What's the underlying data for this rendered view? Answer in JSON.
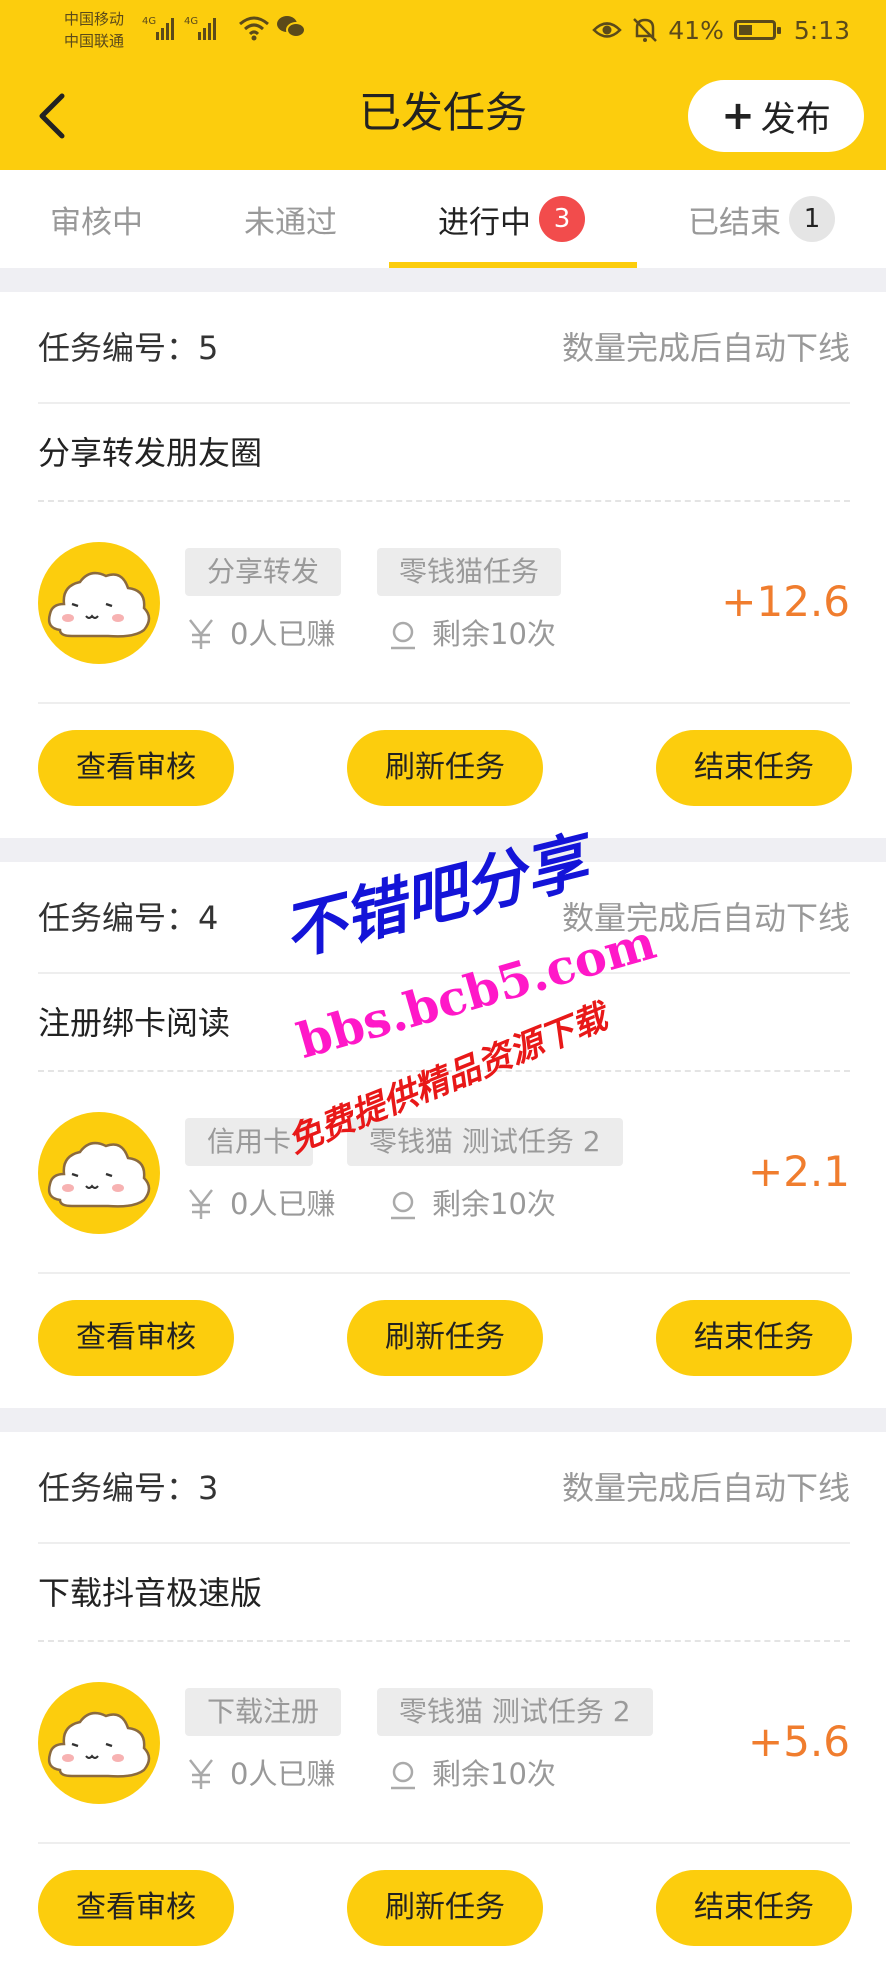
{
  "status_bar": {
    "carrier_1": "中国移动",
    "carrier_2": "中国联通",
    "net_1": "4G",
    "net_2": "4G",
    "battery_percent": "41%",
    "battery_level": 0.41,
    "time": "5:13"
  },
  "header": {
    "title": "已发任务",
    "publish_label": "发布",
    "publish_plus": "+",
    "background_color": "#fccd0d"
  },
  "tabs": [
    {
      "label": "审核中"
    },
    {
      "label": "未通过"
    },
    {
      "label": "进行中",
      "badge": "3",
      "active": true
    },
    {
      "label": "已结束",
      "badge": "1"
    }
  ],
  "tasks": [
    {
      "number_label": "任务编号：5",
      "offline_note": "数量完成后自动下线",
      "name": "分享转发朋友圈",
      "tags": [
        "分享转发",
        "零钱猫任务"
      ],
      "earned": "0人已赚",
      "remaining": "剩余10次",
      "reward": "+12.6",
      "actions": [
        "查看审核",
        "刷新任务",
        "结束任务"
      ]
    },
    {
      "number_label": "任务编号：4",
      "offline_note": "数量完成后自动下线",
      "name": "注册绑卡阅读",
      "tags": [
        "信用卡",
        "零钱猫 测试任务 2"
      ],
      "earned": "0人已赚",
      "remaining": "剩余10次",
      "reward": "+2.1",
      "actions": [
        "查看审核",
        "刷新任务",
        "结束任务"
      ]
    },
    {
      "number_label": "任务编号：3",
      "offline_note": "数量完成后自动下线",
      "name": "下载抖音极速版",
      "tags": [
        "下载注册",
        "零钱猫 测试任务 2"
      ],
      "earned": "0人已赚",
      "remaining": "剩余10次",
      "reward": "+5.6",
      "actions": [
        "查看审核",
        "刷新任务",
        "结束任务"
      ]
    }
  ],
  "watermark": {
    "line1": "不错吧分享",
    "line2": "bbs.bcb5.com",
    "line3": "免费提供精品资源下载"
  },
  "colors": {
    "accent": "#fccd0d",
    "reward": "#f07d2e",
    "badge_red": "#f24c4c"
  }
}
